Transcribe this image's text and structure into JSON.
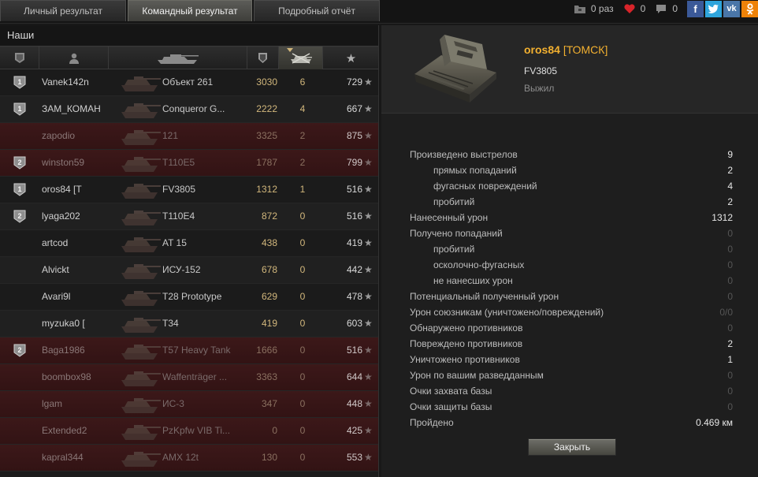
{
  "tabs": [
    {
      "label": "Личный результат",
      "active": false
    },
    {
      "label": "Командный результат",
      "active": true
    },
    {
      "label": "Подробный отчёт",
      "active": false
    }
  ],
  "topbar": {
    "battles_label": "0 раз",
    "likes_count": "0",
    "comments_count": "0",
    "social": [
      "f",
      "t",
      "vk",
      "ok"
    ]
  },
  "team": {
    "title": "Наши",
    "columns": [
      "rank",
      "player",
      "vehicle",
      "damage",
      "kills",
      "xp"
    ],
    "rows": [
      {
        "medal": "1",
        "name": "Vanek142n",
        "tank": "Объект 261",
        "damage": "3030",
        "kills": "6",
        "xp": "729",
        "dead": false
      },
      {
        "medal": "1",
        "name": "ЗАМ_КОМАН",
        "tank": "Conqueror G...",
        "damage": "2222",
        "kills": "4",
        "xp": "667",
        "dead": false
      },
      {
        "medal": "",
        "name": "zapodio",
        "tank": "121",
        "damage": "3325",
        "kills": "2",
        "xp": "875",
        "dead": true
      },
      {
        "medal": "2",
        "name": "winston59",
        "tank": "T110E5",
        "damage": "1787",
        "kills": "2",
        "xp": "799",
        "dead": true
      },
      {
        "medal": "1",
        "name": "oros84 [T",
        "tank": "FV3805",
        "damage": "1312",
        "kills": "1",
        "xp": "516",
        "dead": false
      },
      {
        "medal": "2",
        "name": "lyaga202",
        "tank": "T110E4",
        "damage": "872",
        "kills": "0",
        "xp": "516",
        "dead": false
      },
      {
        "medal": "",
        "name": "artcod",
        "tank": "AT 15",
        "damage": "438",
        "kills": "0",
        "xp": "419",
        "dead": false
      },
      {
        "medal": "",
        "name": "Alvickt",
        "tank": "ИСУ-152",
        "damage": "678",
        "kills": "0",
        "xp": "442",
        "dead": false
      },
      {
        "medal": "",
        "name": "Avari9l",
        "tank": "T28 Prototype",
        "damage": "629",
        "kills": "0",
        "xp": "478",
        "dead": false
      },
      {
        "medal": "",
        "name": "myzuka0 [",
        "tank": "T34",
        "damage": "419",
        "kills": "0",
        "xp": "603",
        "dead": false
      },
      {
        "medal": "2",
        "name": "Baga1986",
        "tank": "T57 Heavy Tank",
        "damage": "1666",
        "kills": "0",
        "xp": "516",
        "dead": true
      },
      {
        "medal": "",
        "name": "boombox98",
        "tank": "Waffenträger ...",
        "damage": "3363",
        "kills": "0",
        "xp": "644",
        "dead": true
      },
      {
        "medal": "",
        "name": "lgam",
        "tank": "ИС-3",
        "damage": "347",
        "kills": "0",
        "xp": "448",
        "dead": true
      },
      {
        "medal": "",
        "name": "Extended2",
        "tank": "PzKpfw VIB Ti...",
        "damage": "0",
        "kills": "0",
        "xp": "425",
        "dead": true
      },
      {
        "medal": "",
        "name": "kapral344",
        "tank": "AMX 12t",
        "damage": "130",
        "kills": "0",
        "xp": "553",
        "dead": true
      }
    ]
  },
  "player": {
    "name": "oros84",
    "clan": "[ТОМСК]",
    "vehicle": "FV3805",
    "status": "Выжил"
  },
  "stats": [
    {
      "label": "Произведено выстрелов",
      "value": "9",
      "sub": false,
      "zero": false
    },
    {
      "label": "прямых попаданий",
      "value": "2",
      "sub": true,
      "zero": false
    },
    {
      "label": "фугасных повреждений",
      "value": "4",
      "sub": true,
      "zero": false
    },
    {
      "label": "пробитий",
      "value": "2",
      "sub": true,
      "zero": false
    },
    {
      "label": "Нанесенный урон",
      "value": "1312",
      "sub": false,
      "zero": false
    },
    {
      "label": "Получено попаданий",
      "value": "0",
      "sub": false,
      "zero": true
    },
    {
      "label": "пробитий",
      "value": "0",
      "sub": true,
      "zero": true
    },
    {
      "label": "осколочно-фугасных",
      "value": "0",
      "sub": true,
      "zero": true
    },
    {
      "label": "не нанесших урон",
      "value": "0",
      "sub": true,
      "zero": true
    },
    {
      "label": "Потенциальный полученный урон",
      "value": "0",
      "sub": false,
      "zero": true
    },
    {
      "label": "Урон союзникам (уничтожено/повреждений)",
      "value": "0/0",
      "sub": false,
      "zero": true
    },
    {
      "label": "Обнаружено противников",
      "value": "0",
      "sub": false,
      "zero": true
    },
    {
      "label": "Повреждено противников",
      "value": "2",
      "sub": false,
      "zero": false
    },
    {
      "label": "Уничтожено противников",
      "value": "1",
      "sub": false,
      "zero": false
    },
    {
      "label": "Урон по вашим разведданным",
      "value": "0",
      "sub": false,
      "zero": true
    },
    {
      "label": "Очки захвата базы",
      "value": "0",
      "sub": false,
      "zero": true
    },
    {
      "label": "Очки защиты базы",
      "value": "0",
      "sub": false,
      "zero": true
    },
    {
      "label": "Пройдено",
      "value": "0.469 км",
      "sub": false,
      "zero": false
    }
  ],
  "close_label": "Закрыть",
  "colors": {
    "accent": "#f2b030",
    "dead_row": "#3a1717",
    "damage_text": "#d2b77c"
  }
}
